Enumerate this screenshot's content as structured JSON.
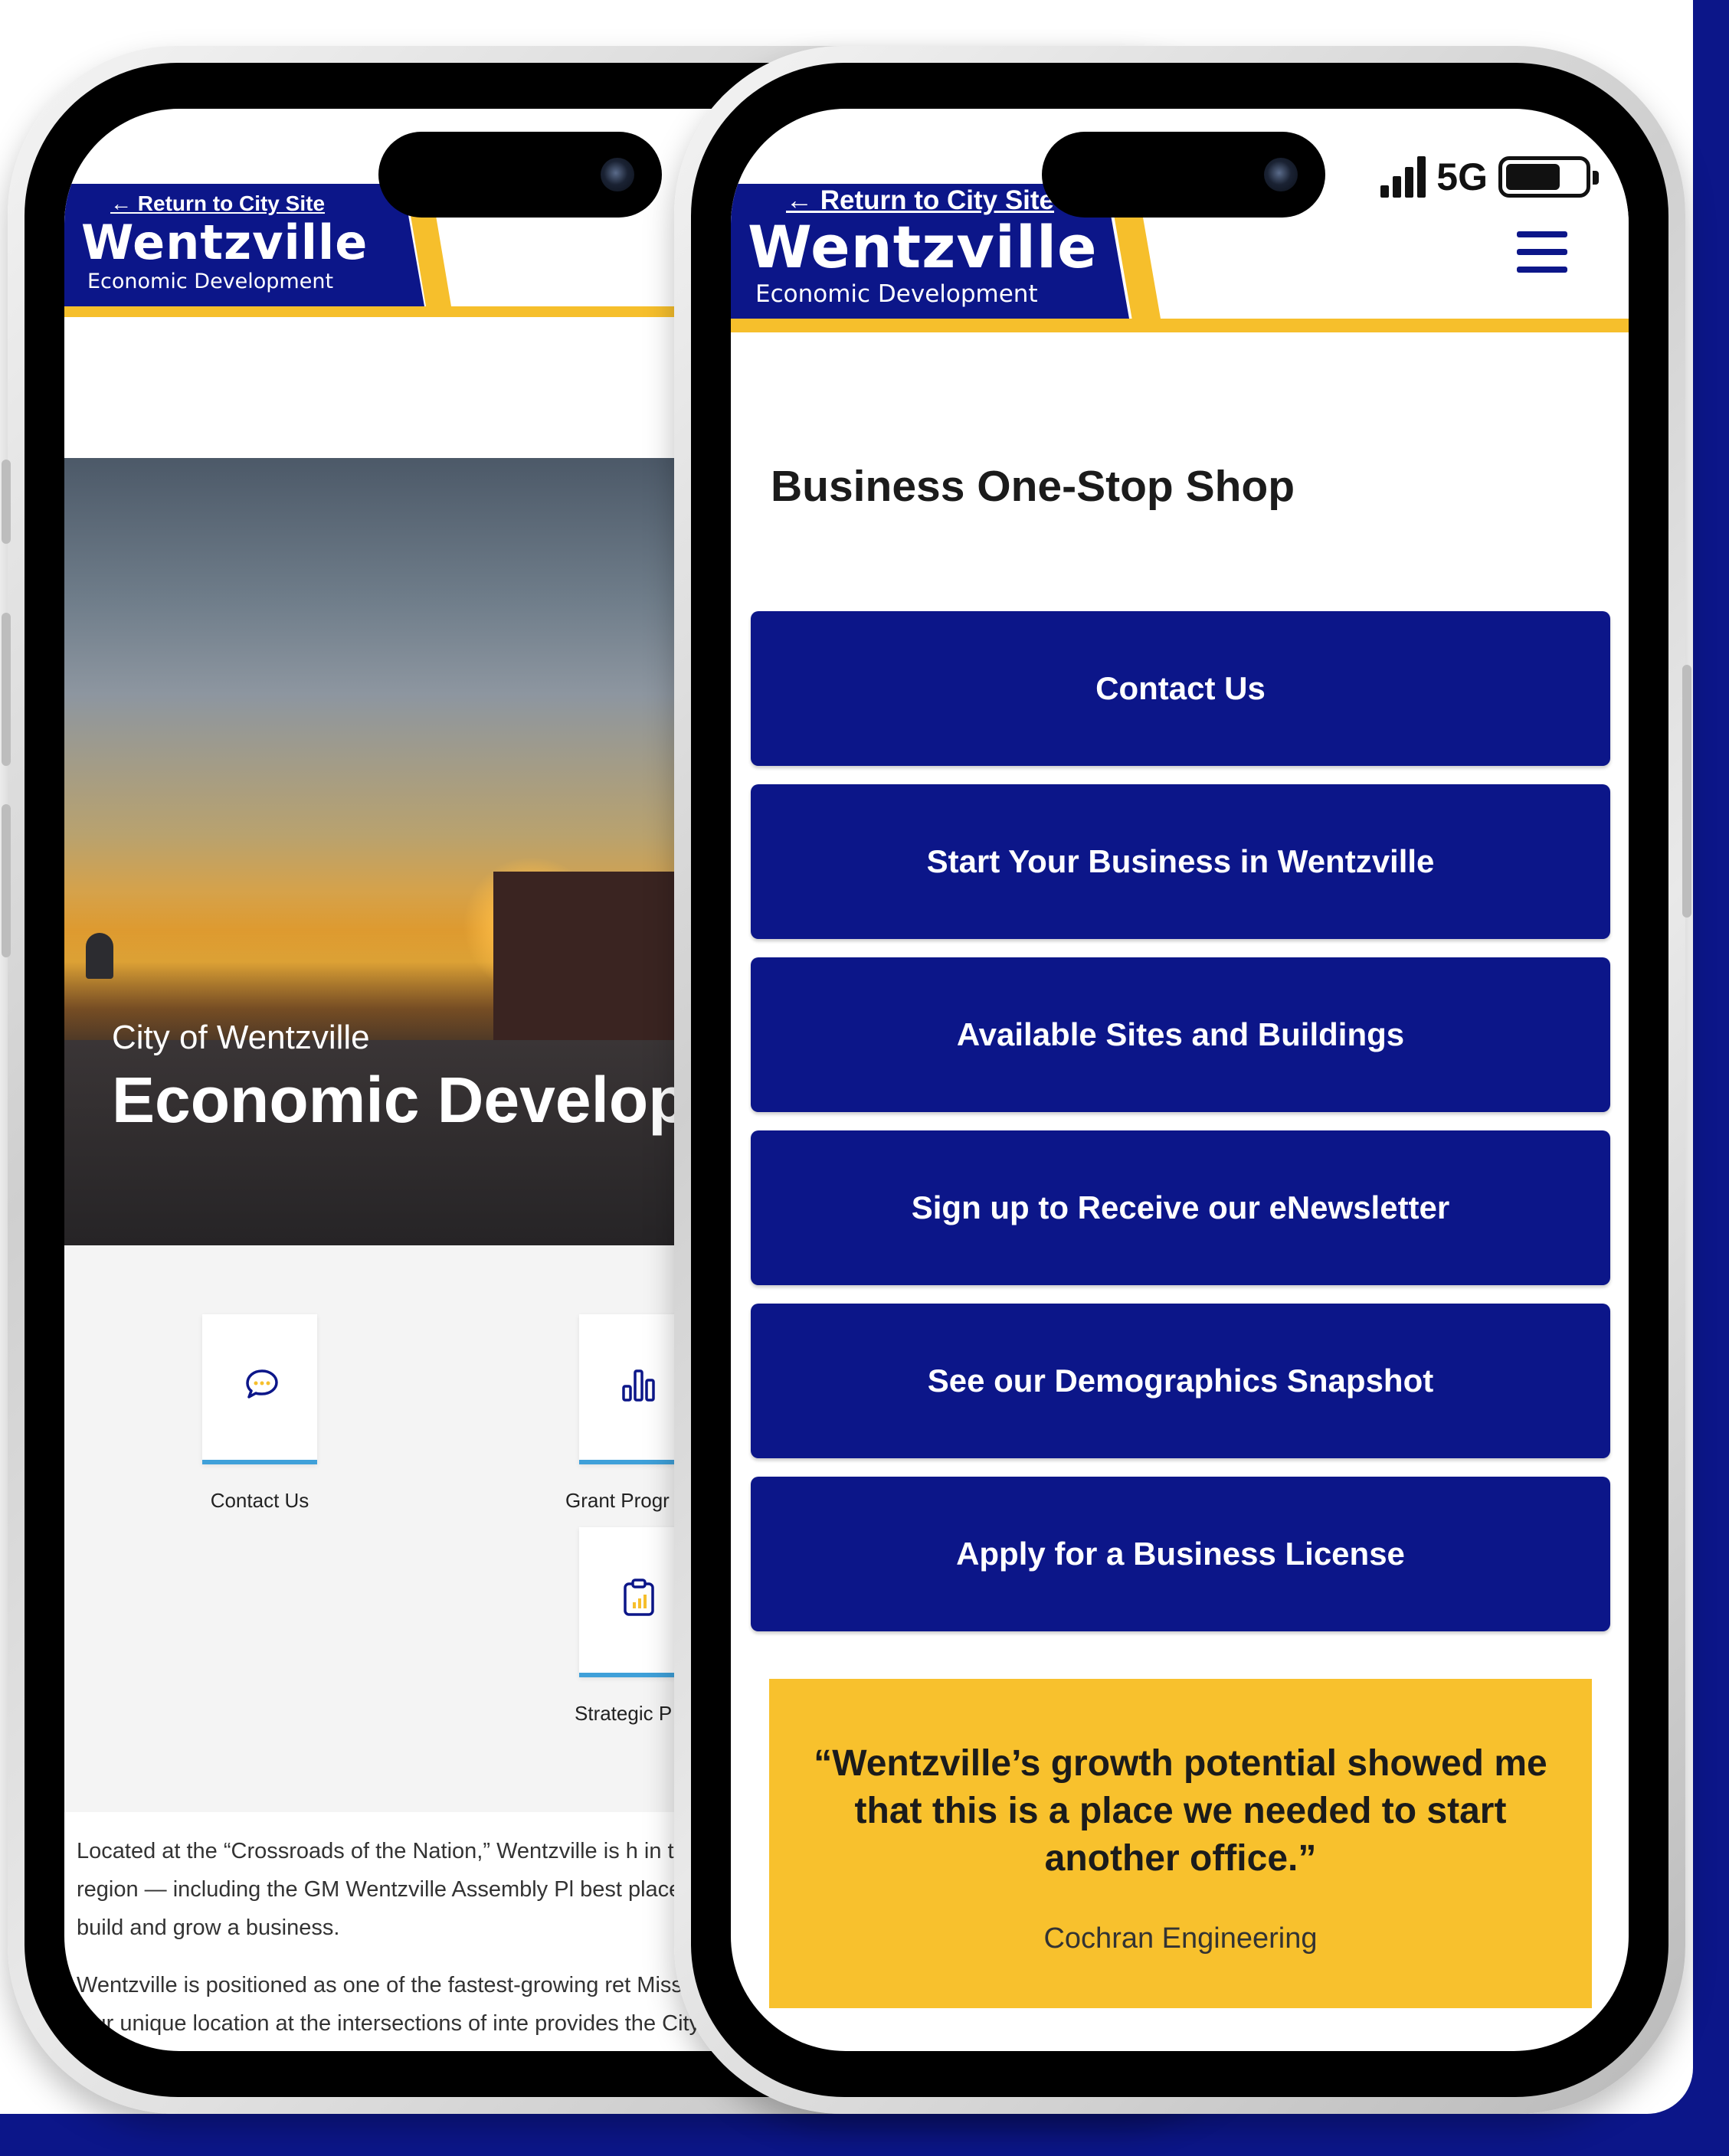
{
  "left_phone": {
    "header": {
      "return_link": "← Return to City Site",
      "brand_name": "Wentzville",
      "brand_sub": "Economic Development"
    },
    "hero": {
      "subtitle": "City of Wentzville",
      "title": "Economic Develop"
    },
    "quick_links": [
      {
        "label": "Contact Us",
        "icon": "chat-icon"
      },
      {
        "label": "Grant Progr",
        "icon": "bar-chart-icon"
      },
      {
        "label": "Strategic P",
        "icon": "clipboard-chart-icon"
      }
    ],
    "paragraphs": [
      "Located at the “Crossroads of the Nation,” Wentzville is h in the region — including the GM Wentzville Assembly Pl best places to build and grow a business.",
      "Wentzville is positioned as one of the fastest-growing ret Missouri. Our unique location at the intersections of inte provides the City with ample opportunities for continued lping businesses succeed through the retention and exp"
    ]
  },
  "right_phone": {
    "status": {
      "network": "5G",
      "signal_icon": "signal-bars-icon",
      "battery_icon": "battery-icon"
    },
    "header": {
      "return_link": "← Return to City Site",
      "brand_name": "Wentzville",
      "brand_sub": "Economic Development",
      "menu_icon": "hamburger-menu-icon"
    },
    "section_title": "Business One-Stop Shop",
    "buttons": [
      "Contact Us",
      "Start Your Business in Wentzville",
      "Available Sites and Buildings",
      "Sign up to Receive our eNewsletter",
      "See our Demographics Snapshot",
      "Apply for a Business License"
    ],
    "testimonial": {
      "quote": "“Wentzville’s growth potential showed me that this is a place we needed to start another office.”",
      "author": "Cochran Engineering"
    }
  },
  "colors": {
    "brand_blue": "#0c1689",
    "brand_gold": "#f6bf2c",
    "accent_cyan": "#3fa0d9"
  }
}
